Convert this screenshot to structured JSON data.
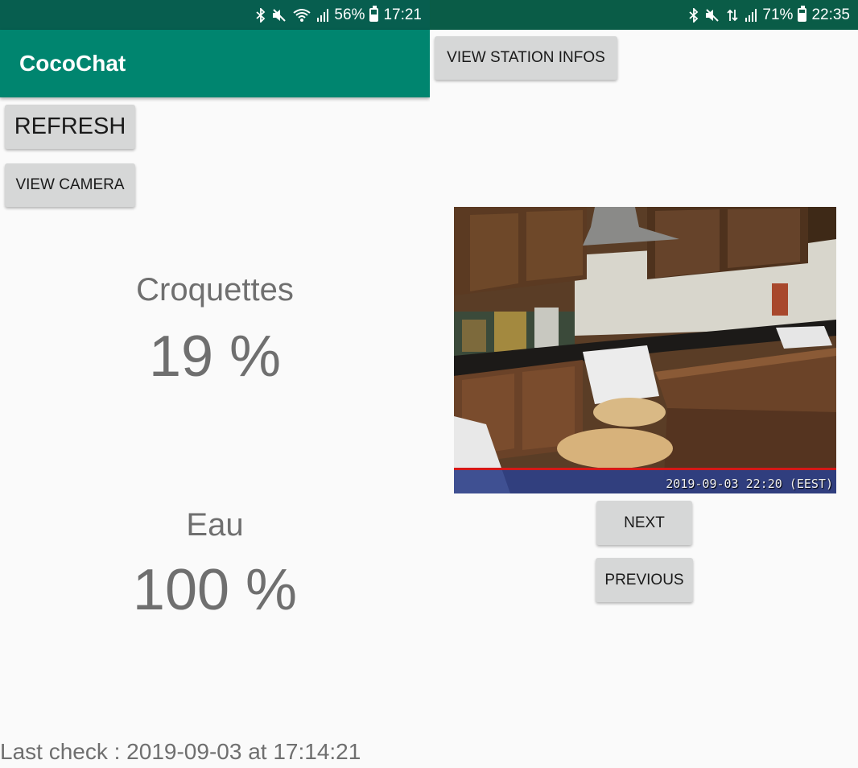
{
  "left": {
    "status_bar": {
      "battery": "56%",
      "time": "17:21"
    },
    "app_title": "CocoChat",
    "buttons": {
      "refresh": "REFRESH",
      "view_camera": "VIEW CAMERA"
    },
    "croquettes": {
      "label": "Croquettes",
      "value": "19 %"
    },
    "eau": {
      "label": "Eau",
      "value": "100 %"
    },
    "last_check": "Last check : 2019-09-03 at 17:14:21"
  },
  "right": {
    "status_bar": {
      "battery": "71%",
      "time": "22:35"
    },
    "buttons": {
      "view_station": "VIEW STATION INFOS",
      "next": "NEXT",
      "previous": "PREVIOUS"
    },
    "camera": {
      "timestamp": "2019-09-03 22:20 (EEST)"
    }
  },
  "colors": {
    "status_bar": "#075e4f",
    "app_bar": "#00856f",
    "button": "#d6d7d7",
    "metric_text": "#6f6f6f"
  },
  "icons": [
    "bluetooth-icon",
    "mute-icon",
    "wifi-icon",
    "signal-icon",
    "data-icon",
    "battery-icon"
  ]
}
